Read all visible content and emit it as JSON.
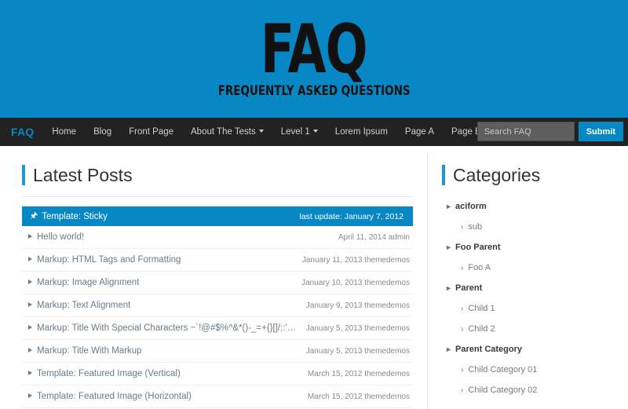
{
  "hero": {
    "title": "FAQ",
    "tagline": "FREQUENTLY ASKED QUESTIONS",
    "background_color": "#0787c3"
  },
  "navbar": {
    "brand": "FAQ",
    "background_color": "#222222",
    "brand_color": "#0787c3",
    "links": [
      {
        "label": "Home",
        "has_caret": false
      },
      {
        "label": "Blog",
        "has_caret": false
      },
      {
        "label": "Front Page",
        "has_caret": false
      },
      {
        "label": "About The Tests",
        "has_caret": true
      },
      {
        "label": "Level 1",
        "has_caret": true
      },
      {
        "label": "Lorem Ipsum",
        "has_caret": false
      },
      {
        "label": "Page A",
        "has_caret": false
      },
      {
        "label": "Page B",
        "has_caret": false
      }
    ],
    "search": {
      "placeholder": "Search FAQ",
      "value": "",
      "submit_label": "Submit"
    }
  },
  "main": {
    "section_title": "Latest Posts",
    "accent_color": "#2196d6",
    "sticky_post": {
      "icon": "pushpin-icon",
      "title": "Template: Sticky",
      "meta": "last update: January 7, 2012"
    },
    "posts": [
      {
        "title": "Hello world!",
        "meta": "April 11, 2014 admin"
      },
      {
        "title": "Markup: HTML Tags and Formatting",
        "meta": "January 11, 2013 themedemos"
      },
      {
        "title": "Markup: Image Alignment",
        "meta": "January 10, 2013 themedemos"
      },
      {
        "title": "Markup: Text Alignment",
        "meta": "January 9, 2013 themedemos"
      },
      {
        "title": "Markup: Title With Special Characters ~`!@#$%^&*()-_=+{}[]/;:'\"?,.>",
        "meta": "January 5, 2013 themedemos"
      },
      {
        "title": "Markup: Title With Markup",
        "meta": "January 5, 2013 themedemos"
      },
      {
        "title": "Template: Featured Image (Vertical)",
        "meta": "March 15, 2012 themedemos"
      },
      {
        "title": "Template: Featured Image (Horizontal)",
        "meta": "March 15, 2012 themedemos"
      }
    ]
  },
  "sidebar": {
    "section_title": "Categories",
    "categories": [
      {
        "label": "aciform",
        "level": "parent"
      },
      {
        "label": "sub",
        "level": "child"
      },
      {
        "label": "Foo Parent",
        "level": "parent"
      },
      {
        "label": "Foo A",
        "level": "child"
      },
      {
        "label": "Parent",
        "level": "parent"
      },
      {
        "label": "Child 1",
        "level": "child"
      },
      {
        "label": "Child 2",
        "level": "child"
      },
      {
        "label": "Parent Category",
        "level": "parent"
      },
      {
        "label": "Child Category 01",
        "level": "child"
      },
      {
        "label": "Child Category 02",
        "level": "child"
      }
    ]
  }
}
